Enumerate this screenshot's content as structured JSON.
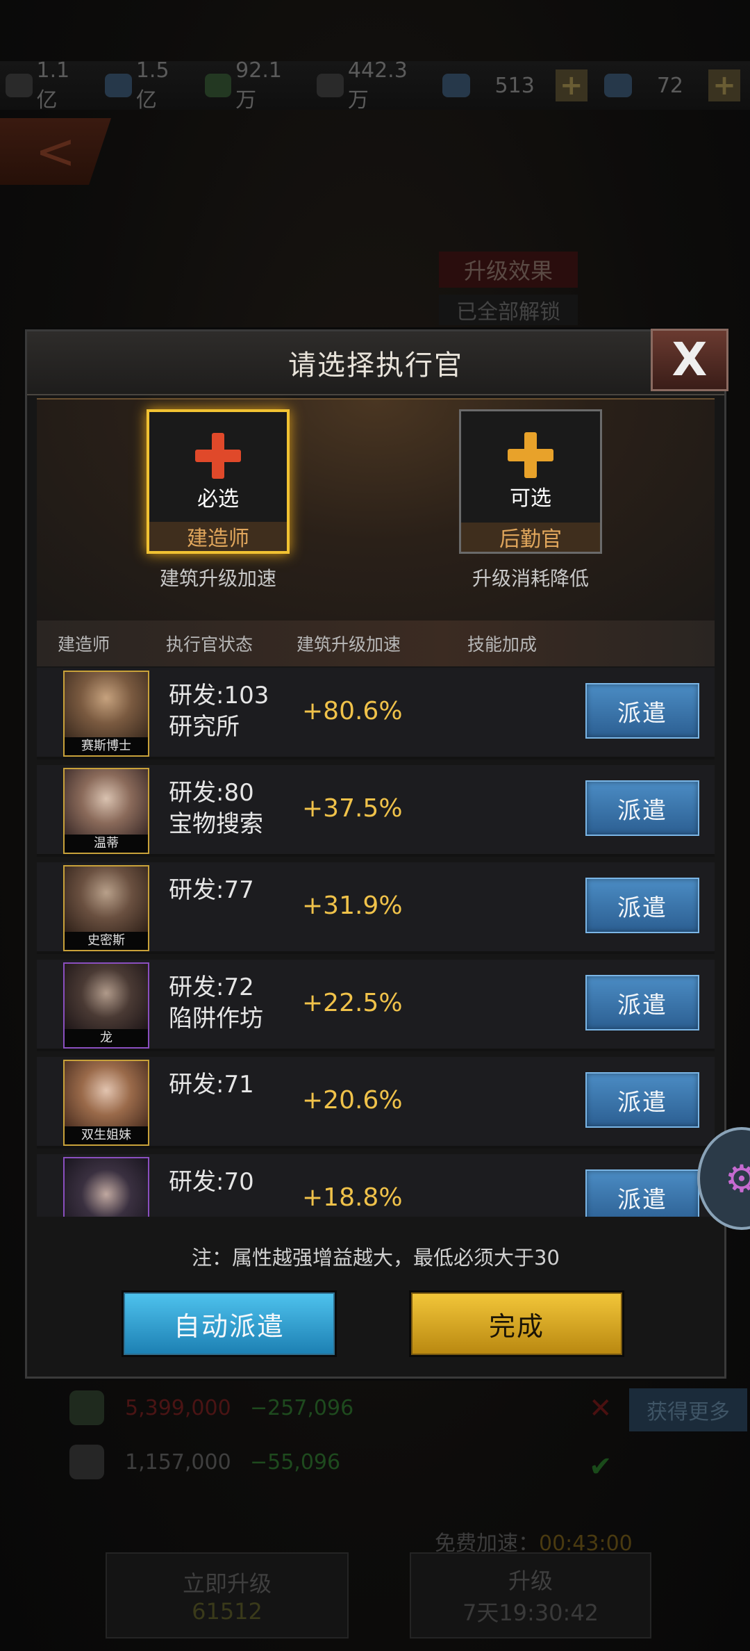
{
  "background": {
    "resources": [
      {
        "icon": "silver-coin-icon",
        "value": "1.1亿"
      },
      {
        "icon": "crystal-icon",
        "value": "1.5亿"
      },
      {
        "icon": "fuel-can-icon",
        "value": "92.1万"
      },
      {
        "icon": "ore-icon",
        "value": "442.3万"
      },
      {
        "icon": "diamond-icon",
        "value": "513"
      },
      {
        "icon": "card-icon",
        "value": "72"
      }
    ],
    "effect_title": "升级效果",
    "effect_sub": "已全部解锁",
    "costs": [
      {
        "icon": "fuel-can-icon",
        "need": "5,399,000",
        "diff": "−257,096"
      },
      {
        "icon": "ore-icon",
        "need": "1,157,000",
        "diff": "−55,096"
      }
    ],
    "get_more": "获得更多",
    "free_speed_label": "免费加速：",
    "free_speed_time": "00:43:00",
    "upgrade_now": "立即升级",
    "upgrade_now_cost": "61512",
    "upgrade": "升级",
    "upgrade_time": "7天19:30:42"
  },
  "modal": {
    "title": "请选择执行官",
    "slots": [
      {
        "tag": "必选",
        "role": "建造师",
        "desc": "建筑升级加速"
      },
      {
        "tag": "可选",
        "role": "后勤官",
        "desc": "升级消耗降低"
      }
    ],
    "columns": [
      "建造师",
      "执行官状态",
      "建筑升级加速",
      "技能加成"
    ],
    "rows": [
      {
        "name": "赛斯博士",
        "status": "研发:103",
        "building": "研究所",
        "bonus": "+80.6%",
        "action": "派遣"
      },
      {
        "name": "温蒂",
        "status": "研发:80",
        "building": "宝物搜索",
        "bonus": "+37.5%",
        "action": "派遣"
      },
      {
        "name": "史密斯",
        "status": "研发:77",
        "building": "",
        "bonus": "+31.9%",
        "action": "派遣"
      },
      {
        "name": "龙",
        "status": "研发:72",
        "building": "陷阱作坊",
        "bonus": "+22.5%",
        "action": "派遣"
      },
      {
        "name": "双生姐妹",
        "status": "研发:71",
        "building": "",
        "bonus": "+20.6%",
        "action": "派遣"
      },
      {
        "name": "",
        "status": "研发:70",
        "building": "",
        "bonus": "+18.8%",
        "action": "派遣"
      }
    ],
    "note": "注：属性越强增益越大，最低必须大于30",
    "auto_button": "自动派遣",
    "done_button": "完成"
  }
}
